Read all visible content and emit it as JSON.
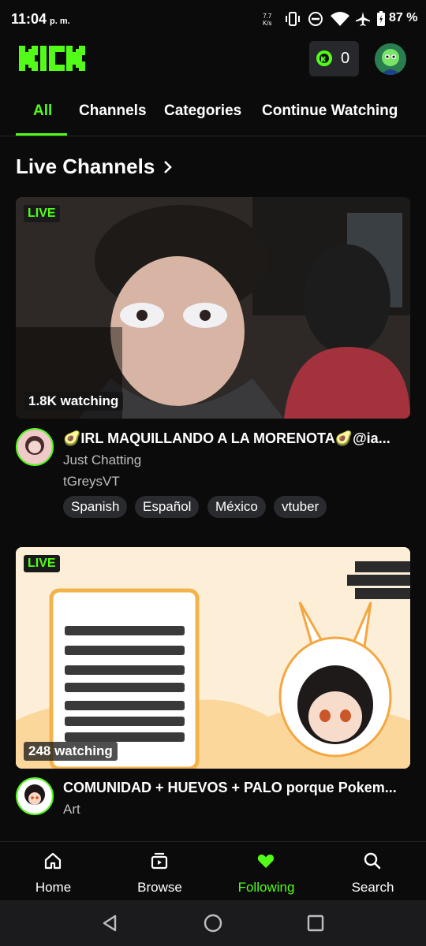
{
  "status_bar": {
    "time": "11:04",
    "ampm": "p. m.",
    "net_speed_value": "7.7",
    "net_speed_unit": "K/s",
    "battery_percent": "87 %"
  },
  "header": {
    "logo_text": "KICK",
    "coin_count": "0"
  },
  "tabs": [
    {
      "label": "All",
      "active": true
    },
    {
      "label": "Channels",
      "active": false
    },
    {
      "label": "Categories",
      "active": false
    },
    {
      "label": "Continue Watching",
      "active": false
    }
  ],
  "section": {
    "title": "Live Channels"
  },
  "streams": [
    {
      "live_label": "LIVE",
      "viewers": "1.8K watching",
      "title": "🥑IRL MAQUILLANDO A LA MORENOTA🥑@ia...",
      "category": "Just Chatting",
      "channel": "tGreysVT",
      "tags": [
        "Spanish",
        "Español",
        "México",
        "vtuber"
      ]
    },
    {
      "live_label": "LIVE",
      "viewers": "248 watching",
      "title": "COMUNIDAD + HUEVOS + PALO porque Pokem...",
      "category": "Art"
    }
  ],
  "bottom_nav": [
    {
      "label": "Home",
      "icon": "home-icon",
      "active": false
    },
    {
      "label": "Browse",
      "icon": "browse-icon",
      "active": false
    },
    {
      "label": "Following",
      "icon": "heart-icon",
      "active": true
    },
    {
      "label": "Search",
      "icon": "search-icon",
      "active": false
    }
  ],
  "colors": {
    "accent": "#53fc18",
    "background": "#0b0b0c",
    "chip": "#2a2b2e"
  }
}
